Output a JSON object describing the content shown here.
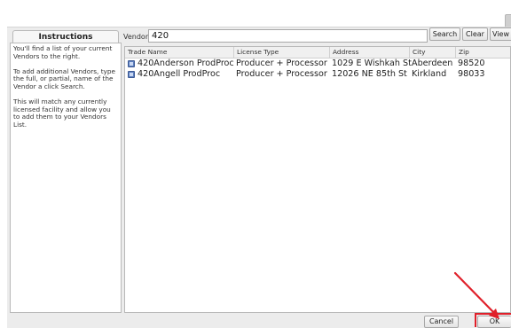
{
  "instructions": {
    "tab_label": "Instructions",
    "paragraphs": [
      "You'll find a list of your current Vendors to the right.",
      "To add additional Vendors, type the full, or partial, name of the Vendor a click Search.",
      "This will match any currently licensed facility and allow you to add them to your Vendors List."
    ]
  },
  "search": {
    "label": "Vendor",
    "value": "420",
    "search_button": "Search",
    "clear_button": "Clear",
    "view_all_button": "View A"
  },
  "table": {
    "columns": [
      "Trade Name",
      "License Type",
      "Address",
      "City",
      "Zip"
    ],
    "rows": [
      {
        "trade_name": "420Anderson ProdProc",
        "license_type": "Producer + Processor",
        "address": "1029 E Wishkah St",
        "city": "Aberdeen",
        "zip": "98520"
      },
      {
        "trade_name": "420Angell ProdProc",
        "license_type": "Producer + Processor",
        "address": "12026 NE 85th St",
        "city": "Kirkland",
        "zip": "98033"
      }
    ]
  },
  "footer": {
    "cancel_button": "Cancel",
    "ok_button": "OK"
  },
  "colors": {
    "highlight": "#e0202a",
    "row_icon": "#5d7fbf"
  }
}
